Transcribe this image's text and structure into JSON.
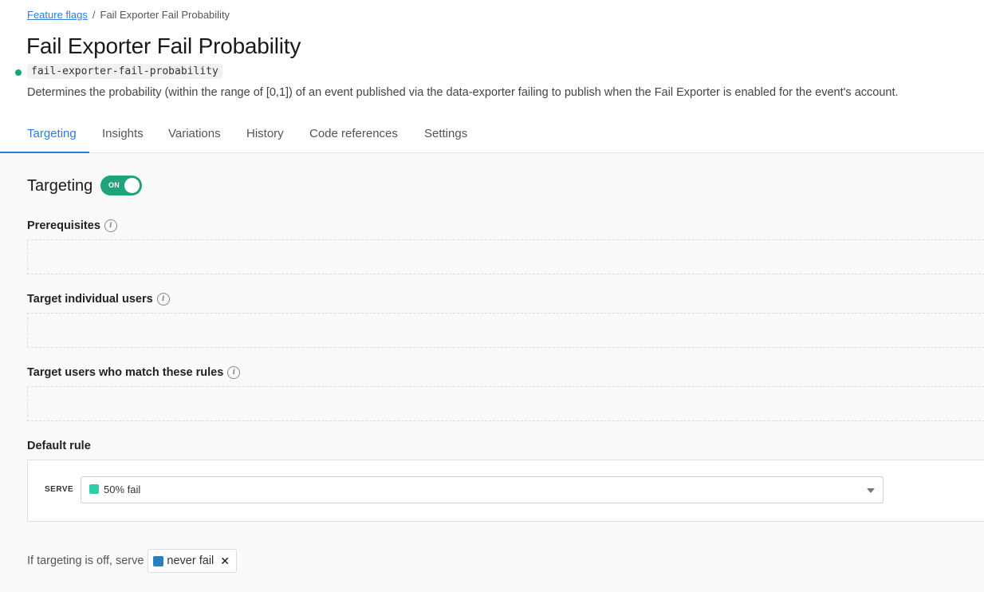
{
  "breadcrumb": {
    "link": "Feature flags",
    "separator": "/",
    "current": "Fail Exporter Fail Probability"
  },
  "flag": {
    "title": "Fail Exporter Fail Probability",
    "key": "fail-exporter-fail-probability",
    "description": "Determines the probability (within the range of [0,1]) of an event published via the data-exporter failing to publish when the Fail Exporter is enabled for the event's account."
  },
  "tabs": [
    {
      "label": "Targeting",
      "active": true
    },
    {
      "label": "Insights"
    },
    {
      "label": "Variations"
    },
    {
      "label": "History"
    },
    {
      "label": "Code references"
    },
    {
      "label": "Settings"
    }
  ],
  "targeting": {
    "heading": "Targeting",
    "toggle_label": "ON",
    "prerequisites": "Prerequisites",
    "target_individual_users": "Target individual users",
    "target_rules": "Target users who match these rules",
    "default_rule": "Default rule",
    "serve_label": "SERVE",
    "serve_value": "50% fail",
    "off_text": "If targeting is off, serve",
    "off_value": "never fail"
  },
  "colors": {
    "accent": "#2f7bd9",
    "toggle_on": "#1ea37a",
    "status_dot": "#16a57a",
    "swatch_fail": "#2ecfa6",
    "swatch_never_fail": "#2b7fc1"
  },
  "icons": {
    "info": "info-icon",
    "caret": "chevron-down-icon",
    "remove": "close-icon"
  }
}
